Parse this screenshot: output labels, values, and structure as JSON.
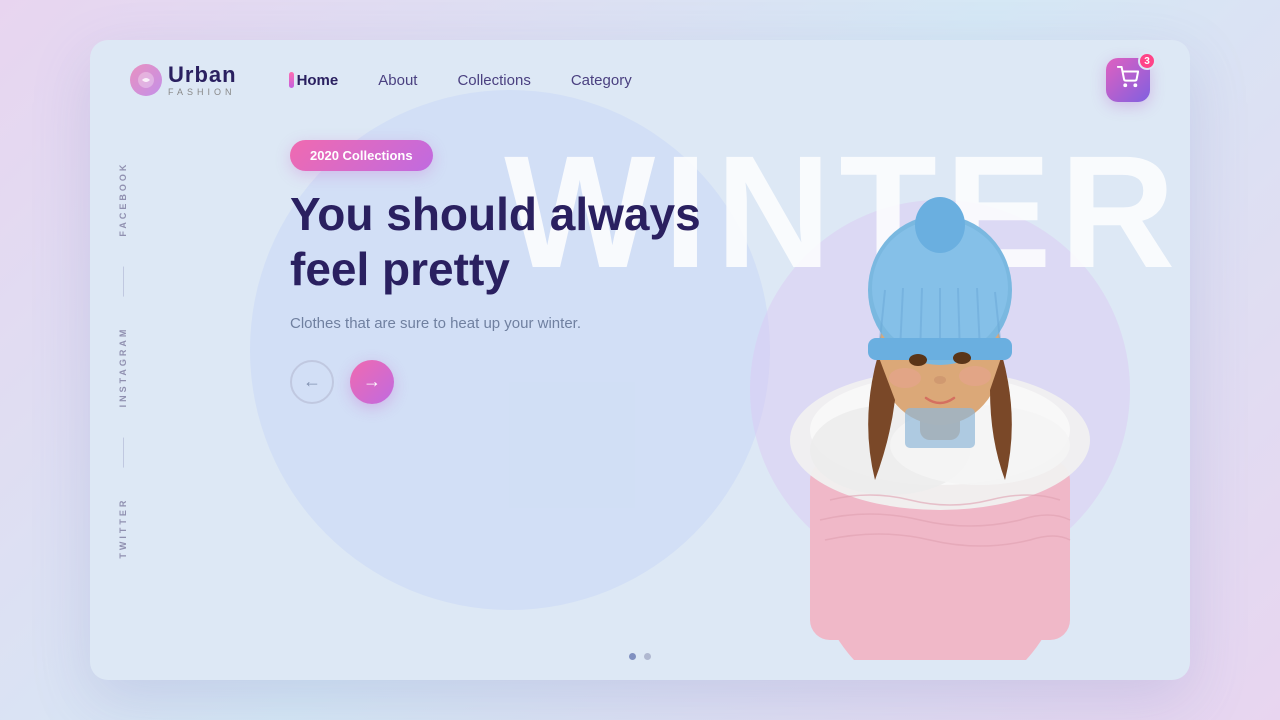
{
  "meta": {
    "title": "Urban Fashion"
  },
  "logo": {
    "brand": "Urban",
    "sub": "FASHION",
    "icon": "★"
  },
  "nav": {
    "items": [
      {
        "label": "Home",
        "active": true
      },
      {
        "label": "About",
        "active": false
      },
      {
        "label": "Collections",
        "active": false
      },
      {
        "label": "Category",
        "active": false
      }
    ],
    "cart_badge": "3"
  },
  "hero": {
    "badge": "2020 Collections",
    "title_line1": "You should always",
    "title_line2": "feel pretty",
    "subtitle": "Clothes that are sure to heat up your winter.",
    "bg_text": "WINTER"
  },
  "buttons": {
    "prev_label": "←",
    "next_label": "→"
  },
  "social": {
    "items": [
      "FACEBOOK",
      "INSTAGRAM",
      "TWITTER"
    ]
  },
  "dots": [
    true,
    false
  ]
}
